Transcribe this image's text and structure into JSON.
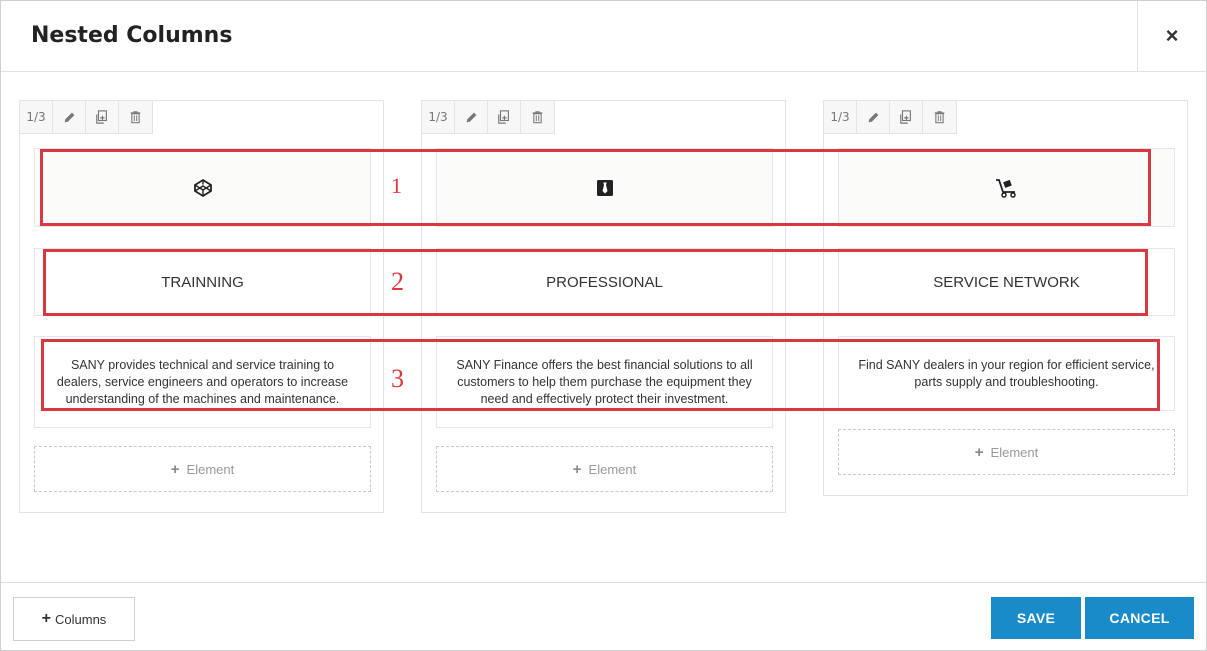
{
  "dialog": {
    "title": "Nested Columns",
    "close_glyph": "×"
  },
  "column_tools": {
    "size_label": "1/3",
    "icons": [
      "pencil-icon",
      "clone-icon",
      "trash-icon"
    ]
  },
  "columns": [
    {
      "icon": "codepen-icon",
      "heading": "TRAINNING",
      "text": "SANY provides technical and service training to dealers, service engineers and operators to increase understanding of the machines and maintenance."
    },
    {
      "icon": "tie-icon",
      "heading": "PROFESSIONAL",
      "text": "SANY Finance offers the best financial solutions to all customers to help them purchase the equipment they need and effectively protect their investment."
    },
    {
      "icon": "dolly-icon",
      "heading": "SERVICE NETWORK",
      "text": "Find SANY dealers in your region for efficient service, parts supply and troubleshooting."
    }
  ],
  "add_element_label": "Element",
  "annotations": [
    "1",
    "2",
    "3"
  ],
  "annotation_color": "#d9383f",
  "footer": {
    "add_columns_label": "Columns",
    "save_label": "SAVE",
    "cancel_label": "CANCEL"
  },
  "accent_color": "#1a8bc9"
}
